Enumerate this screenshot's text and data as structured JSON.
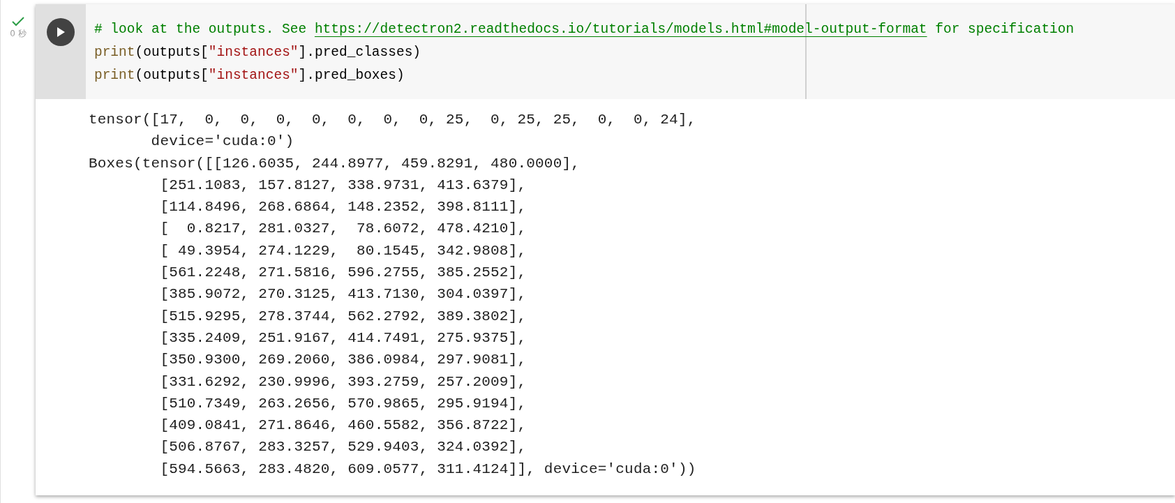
{
  "cell": {
    "status": {
      "done": true,
      "duration": "0 秒"
    },
    "code_lines": [
      [
        {
          "kind": "comment",
          "text": "# look at the outputs. See "
        },
        {
          "kind": "link",
          "text": "https://detectron2.readthedocs.io/tutorials/models.html#model-output-format"
        },
        {
          "kind": "comment",
          "text": " for specification"
        }
      ],
      [
        {
          "kind": "builtin",
          "text": "print"
        },
        {
          "kind": "plain",
          "text": "(outputs["
        },
        {
          "kind": "string",
          "text": "\"instances\""
        },
        {
          "kind": "plain",
          "text": "].pred_classes)"
        }
      ],
      [
        {
          "kind": "builtin",
          "text": "print"
        },
        {
          "kind": "plain",
          "text": "(outputs["
        },
        {
          "kind": "string",
          "text": "\"instances\""
        },
        {
          "kind": "plain",
          "text": "].pred_boxes)"
        }
      ]
    ],
    "output_lines": [
      "tensor([17,  0,  0,  0,  0,  0,  0,  0, 25,  0, 25, 25,  0,  0, 24],",
      "       device='cuda:0')",
      "Boxes(tensor([[126.6035, 244.8977, 459.8291, 480.0000],",
      "        [251.1083, 157.8127, 338.9731, 413.6379],",
      "        [114.8496, 268.6864, 148.2352, 398.8111],",
      "        [  0.8217, 281.0327,  78.6072, 478.4210],",
      "        [ 49.3954, 274.1229,  80.1545, 342.9808],",
      "        [561.2248, 271.5816, 596.2755, 385.2552],",
      "        [385.9072, 270.3125, 413.7130, 304.0397],",
      "        [515.9295, 278.3744, 562.2792, 389.3802],",
      "        [335.2409, 251.9167, 414.7491, 275.9375],",
      "        [350.9300, 269.2060, 386.0984, 297.9081],",
      "        [331.6292, 230.9996, 393.2759, 257.2009],",
      "        [510.7349, 263.2656, 570.9865, 295.9194],",
      "        [409.0841, 271.8646, 460.5582, 356.8722],",
      "        [506.8767, 283.3257, 529.9403, 324.0392],",
      "        [594.5663, 283.4820, 609.0577, 311.4124]], device='cuda:0'))"
    ]
  }
}
